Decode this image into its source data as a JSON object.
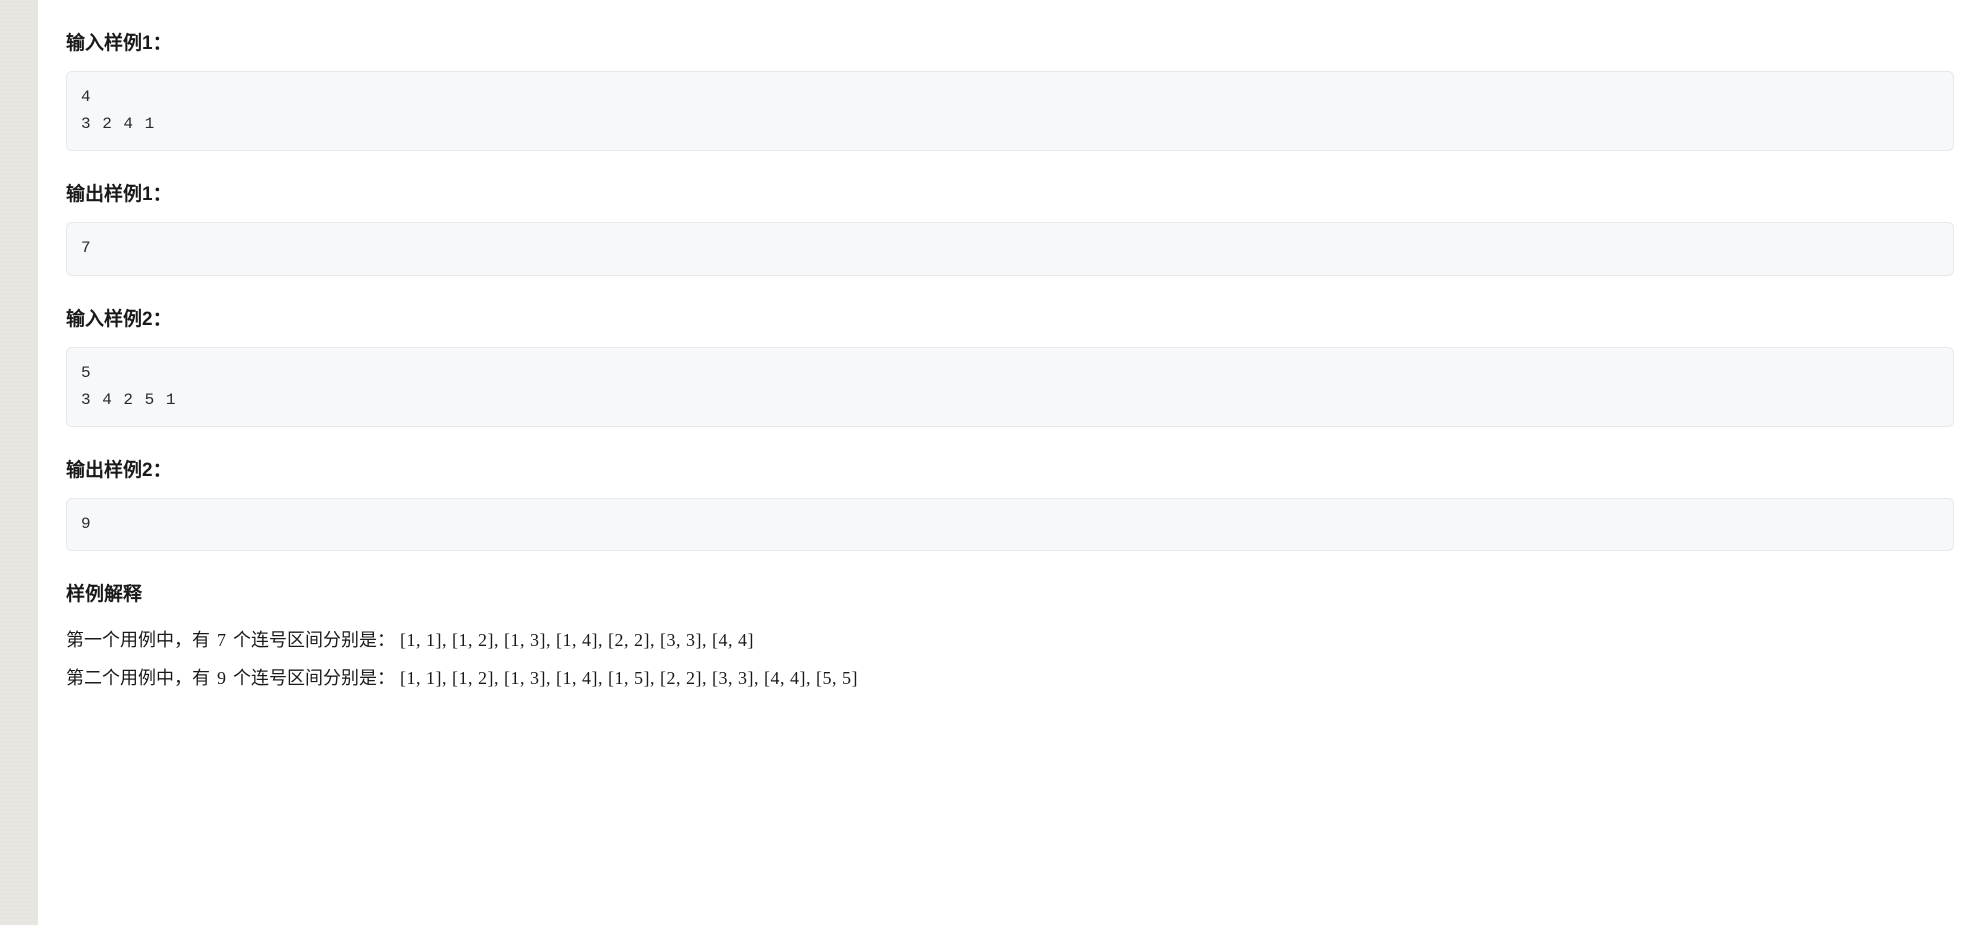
{
  "sections": {
    "input1": {
      "title": "输入样例1：",
      "content": "4\n3 2 4 1"
    },
    "output1": {
      "title": "输出样例1：",
      "content": "7"
    },
    "input2": {
      "title": "输入样例2：",
      "content": "5\n3 4 2 5 1"
    },
    "output2": {
      "title": "输出样例2：",
      "content": "9"
    },
    "explanation": {
      "title": "样例解释",
      "line1_prefix": "第一个用例中，有 ",
      "line1_count": "7",
      "line1_mid": " 个连号区间分别是：",
      "line1_intervals": "[1, 1], [1, 2], [1, 3], [1, 4], [2, 2], [3, 3], [4, 4]",
      "line2_prefix": "第二个用例中，有 ",
      "line2_count": "9",
      "line2_mid": " 个连号区间分别是：",
      "line2_intervals": "[1, 1], [1, 2], [1, 3], [1, 4], [1, 5], [2, 2], [3, 3], [4, 4], [5, 5]"
    }
  }
}
